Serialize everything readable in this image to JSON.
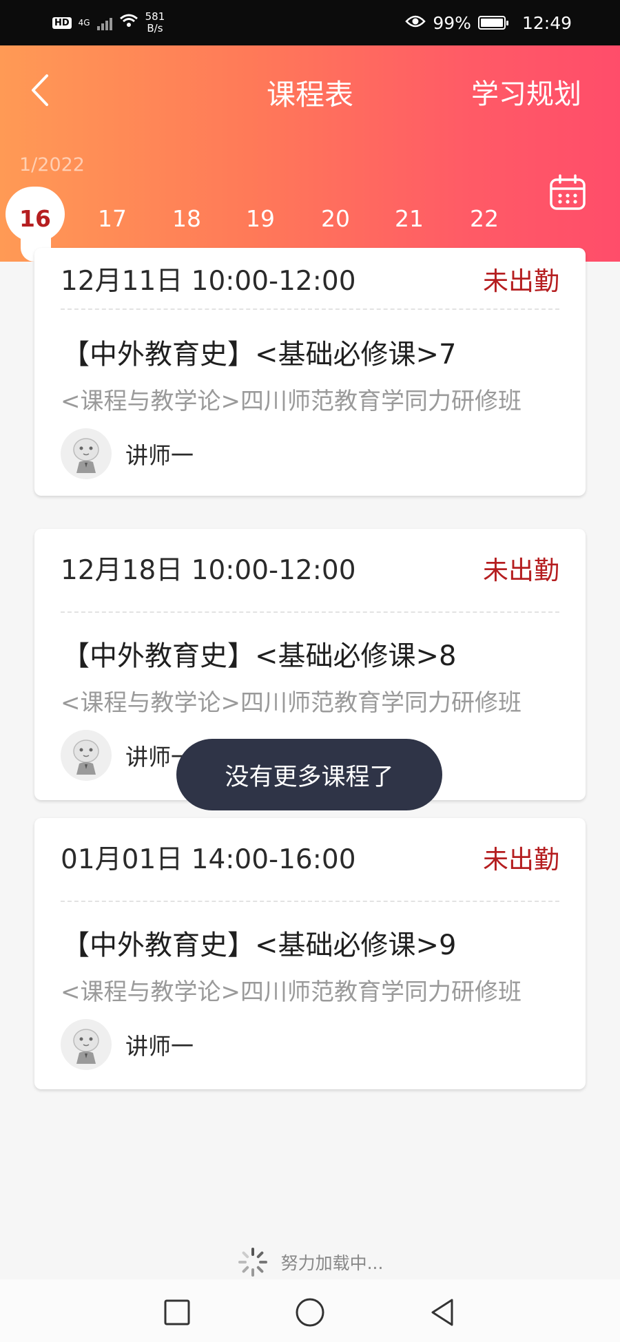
{
  "status_bar": {
    "hd": "HD",
    "network": "4G",
    "speed_value": "581",
    "speed_unit": "B/s",
    "battery": "99%",
    "time": "12:49"
  },
  "header": {
    "title": "课程表",
    "plan_label": "学习规划",
    "month_label": "1/2022",
    "days": [
      "16",
      "17",
      "18",
      "19",
      "20",
      "21",
      "22"
    ],
    "selected_day": "16"
  },
  "courses": [
    {
      "time": "12月11日 10:00-12:00",
      "status": "未出勤",
      "title": "【中外教育史】<基础必修课>7",
      "subtitle": "<课程与教学论>四川师范教育学同力研修班",
      "teacher": "讲师一"
    },
    {
      "time": "12月18日 10:00-12:00",
      "status": "未出勤",
      "title": "【中外教育史】<基础必修课>8",
      "subtitle": "<课程与教学论>四川师范教育学同力研修班",
      "teacher": "讲师一"
    },
    {
      "time": "01月01日 14:00-16:00",
      "status": "未出勤",
      "title": "【中外教育史】<基础必修课>9",
      "subtitle": "<课程与教学论>四川师范教育学同力研修班",
      "teacher": "讲师一"
    }
  ],
  "toast": "没有更多课程了",
  "loading_text": "努力加载中...",
  "colors": {
    "header_start": "#ff9a55",
    "header_end": "#ff4d6a",
    "status_red": "#b51e20",
    "toast_bg": "#2f3447"
  },
  "icons": {
    "back": "chevron-left-icon",
    "calendar": "calendar-icon",
    "avatar": "tiger-avatar-icon",
    "spinner": "spinner-icon",
    "nav_recent": "square-icon",
    "nav_home": "circle-icon",
    "nav_back": "triangle-back-icon"
  }
}
